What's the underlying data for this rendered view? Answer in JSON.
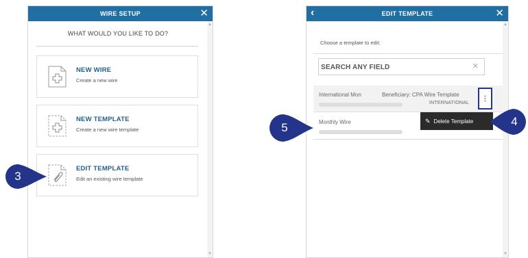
{
  "left": {
    "header": {
      "title": "WIRE SETUP",
      "close_glyph": "✕"
    },
    "question": "WHAT WOULD YOU LIKE TO DO?",
    "options": [
      {
        "title": "NEW WIRE",
        "subtitle": "Create a new wire",
        "icon": "plus-document-icon"
      },
      {
        "title": "NEW TEMPLATE",
        "subtitle": "Create a new wire template",
        "icon": "plus-template-icon"
      },
      {
        "title": "EDIT TEMPLATE",
        "subtitle": "Edit an existing wire template",
        "icon": "paperclip-template-icon"
      }
    ]
  },
  "right": {
    "header": {
      "title": "EDIT TEMPLATE",
      "back_glyph": "‹",
      "close_glyph": "✕"
    },
    "instruction": "Choose a template to edit:",
    "search": {
      "placeholder": "SEARCH ANY FIELD",
      "value": "",
      "clear_glyph": "✕"
    },
    "templates": [
      {
        "name": "International Mon",
        "beneficiary": "Beneficiary: CPA Wire Template",
        "type": "INTERNATIONAL"
      },
      {
        "name": "Monthly Wire"
      }
    ],
    "kebab_glyph": "⋮",
    "context_menu": {
      "label": "Delete Template",
      "icon": "pencil-icon",
      "icon_glyph": "✎"
    }
  },
  "callouts": [
    {
      "number": "3"
    },
    {
      "number": "4"
    },
    {
      "number": "5"
    }
  ],
  "colors": {
    "header_blue": "#1f6fa3",
    "title_blue": "#1f5f8f",
    "callout_navy": "#23348a",
    "menu_dark": "#2b2b2b"
  }
}
